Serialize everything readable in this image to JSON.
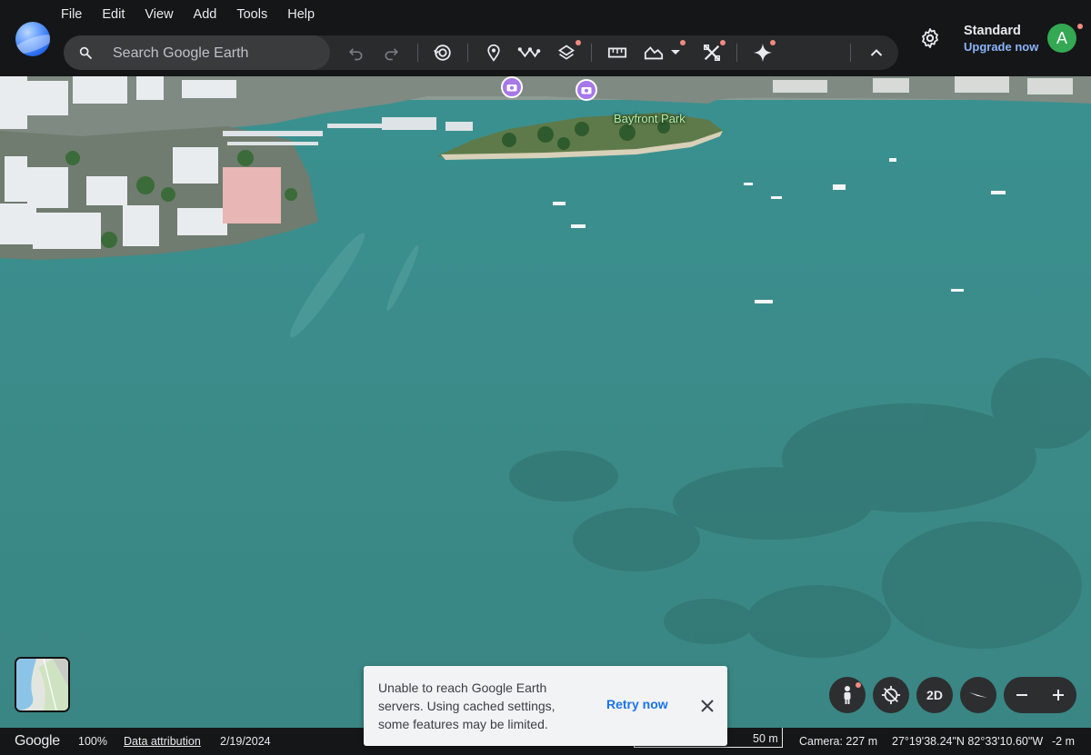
{
  "menu": [
    "File",
    "Edit",
    "View",
    "Add",
    "Tools",
    "Help"
  ],
  "search": {
    "placeholder": "Search Google Earth"
  },
  "account": {
    "plan": "Standard",
    "upgrade": "Upgrade now",
    "avatar_letter": "A"
  },
  "toolbar_icons": [
    "undo-icon",
    "redo-icon",
    "history-icon",
    "placemark-icon",
    "path-icon",
    "layers-icon",
    "ruler-icon",
    "elevation-icon",
    "measure-tools-icon",
    "sparkle-icon",
    "collapse-chevron-icon"
  ],
  "map": {
    "place_label": "Bayfront Park"
  },
  "controls": {
    "mode_2d": "2D"
  },
  "toast": {
    "message": "Unable to reach Google Earth servers. Using cached settings, some features may be limited.",
    "action": "Retry now"
  },
  "status": {
    "google": "Google",
    "zoom": "100%",
    "attribution": "Data attribution",
    "imagery_date": "2/19/2024",
    "scale": "50 m",
    "camera": "Camera: 227 m",
    "coordinates": "27°19'38.24\"N 82°33'10.60\"W",
    "elevation": "-2 m"
  },
  "colors": {
    "water": "#3b8d8c",
    "toolbar": "#2a2b2d",
    "accent_link": "#8ab4f8",
    "avatar": "#34a853",
    "notification_dot": "#f28b82"
  }
}
